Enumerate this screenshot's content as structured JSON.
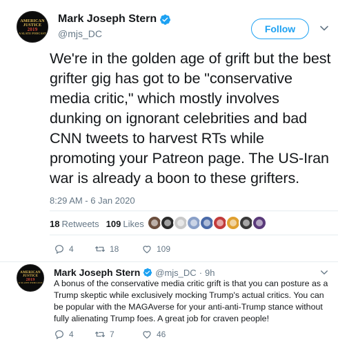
{
  "main_tweet": {
    "author_name": "Mark Joseph Stern",
    "handle": "@mjs_DC",
    "follow_label": "Follow",
    "avatar_text": [
      "AMERICAN",
      "JUSTICE",
      "2019",
      "A SLATE PODCAST"
    ],
    "text": "We're in the golden age of grift but the best grifter gig has got to be \"conservative media critic,\" which mostly involves dunking on ignorant celebrities and bad CNN tweets to harvest RTs while promoting your Patreon page. The US-Iran war is already a boon to these grifters.",
    "timestamp": "8:29 AM - 6 Jan 2020",
    "retweets_count": "18",
    "retweets_label": "Retweets",
    "likes_count": "109",
    "likes_label": "Likes",
    "liker_avatars": [
      "#6b4e3d",
      "#2b2b2b",
      "#c9c9c9",
      "#8aa0c8",
      "#4a6aa8",
      "#c23b3b",
      "#e0a030",
      "#3a3a3a",
      "#5a3a7a"
    ],
    "actions": {
      "reply": "4",
      "retweet": "18",
      "like": "109"
    }
  },
  "reply_tweet": {
    "author_name": "Mark Joseph Stern",
    "handle": "@mjs_DC",
    "time": "9h",
    "avatar_text": [
      "AMERICAN",
      "JUSTICE",
      "2019",
      "A SLATE PODCAST"
    ],
    "text": "A bonus of the conservative media critic grift is that you can posture as a Trump skeptic while exclusively mocking Trump's actual critics. You can be popular with the MAGAverse for your anti-anti-Trump stance without fully alienating Trump foes. A great job for craven people!",
    "actions": {
      "reply": "4",
      "retweet": "7",
      "like": "46"
    }
  },
  "colors": {
    "accent": "#1da1f2",
    "muted": "#657786",
    "text": "#14171a",
    "divider": "#e6ecf0"
  }
}
